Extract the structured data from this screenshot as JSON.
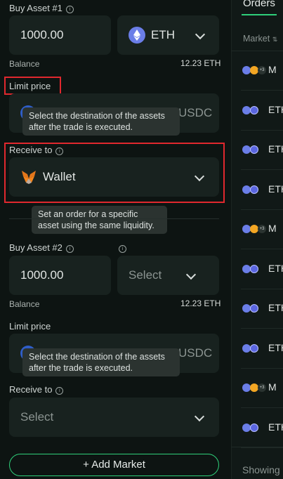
{
  "form": {
    "asset1": {
      "label": "Buy Asset #1",
      "amount": "1000.00",
      "token": "ETH",
      "balance_label": "Balance",
      "balance_value": "12.23 ETH",
      "limit_label": "Limit price",
      "limit_unit": "USDC",
      "receive_label": "Receive to",
      "receive_value": "Wallet"
    },
    "asset2": {
      "label": "Buy Asset #2",
      "amount": "1000.00",
      "token_placeholder": "Select",
      "balance_label": "Balance",
      "balance_value": "12.23 ETH",
      "limit_label": "Limit price",
      "limit_unit": "USDC",
      "receive_label": "Receive to",
      "receive_placeholder": "Select"
    },
    "add_market_label": "+ Add Market"
  },
  "tooltips": {
    "destination": "Select the destination of the assets after the trade is executed.",
    "specific_asset": "Set an order for a specific asset using the same liquidity."
  },
  "orders_panel": {
    "title": "Orders",
    "column_market": "Market",
    "rows": [
      {
        "text": "M",
        "badge": "+3"
      },
      {
        "text": "ETH"
      },
      {
        "text": "ETH"
      },
      {
        "text": "ETH"
      },
      {
        "text": "M",
        "badge": "+3"
      },
      {
        "text": "ETH"
      },
      {
        "text": "ETH"
      },
      {
        "text": "ETH"
      },
      {
        "text": "M",
        "badge": "+3"
      },
      {
        "text": "ETH"
      }
    ],
    "footer": "Showing"
  },
  "colors": {
    "accent_green": "#2fd07a",
    "highlight_red": "#e0282e",
    "eth_purple": "#6b7ee8"
  }
}
